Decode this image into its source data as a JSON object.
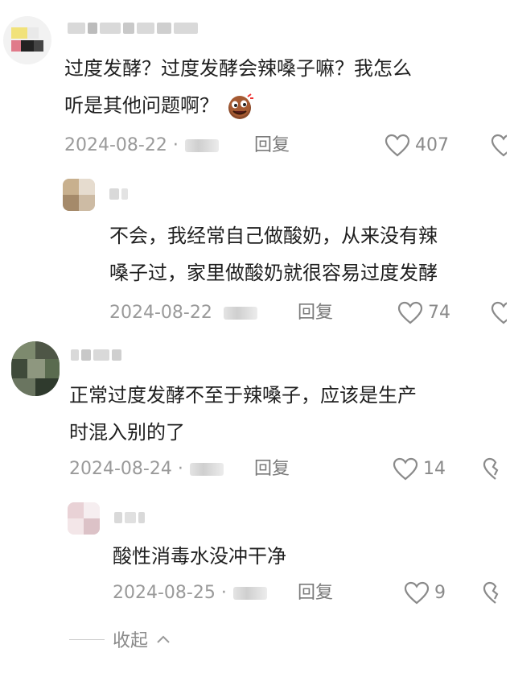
{
  "comments": [
    {
      "text_lines": [
        "过度发酵？过度发酵会辣嗓子嘛？我怎么",
        "听是其他问题啊？"
      ],
      "date": "2024-08-22",
      "reply_label": "回复",
      "likes": "407",
      "emoji": "laughing-face-emoji"
    },
    {
      "text_lines": [
        "不会，我经常自己做酸奶，从来没有辣",
        "嗓子过，家里做酸奶就很容易过度发酵"
      ],
      "date": "2024-08-22",
      "reply_label": "回复",
      "likes": "74"
    },
    {
      "text_lines": [
        "正常过度发酵不至于辣嗓子，应该是生产",
        "时混入别的了"
      ],
      "date": "2024-08-24",
      "reply_label": "回复",
      "likes": "14"
    },
    {
      "text_lines": [
        "酸性消毒水没冲干净"
      ],
      "date": "2024-08-25",
      "reply_label": "回复",
      "likes": "9"
    }
  ],
  "collapse_label": "收起",
  "icons": {
    "like": "heart-outline-icon",
    "dislike": "broken-heart-icon",
    "collapse": "chevron-up-icon"
  },
  "colors": {
    "text": "#1f1f1f",
    "meta": "#9a9a9a",
    "reply": "#7a7a7a"
  }
}
